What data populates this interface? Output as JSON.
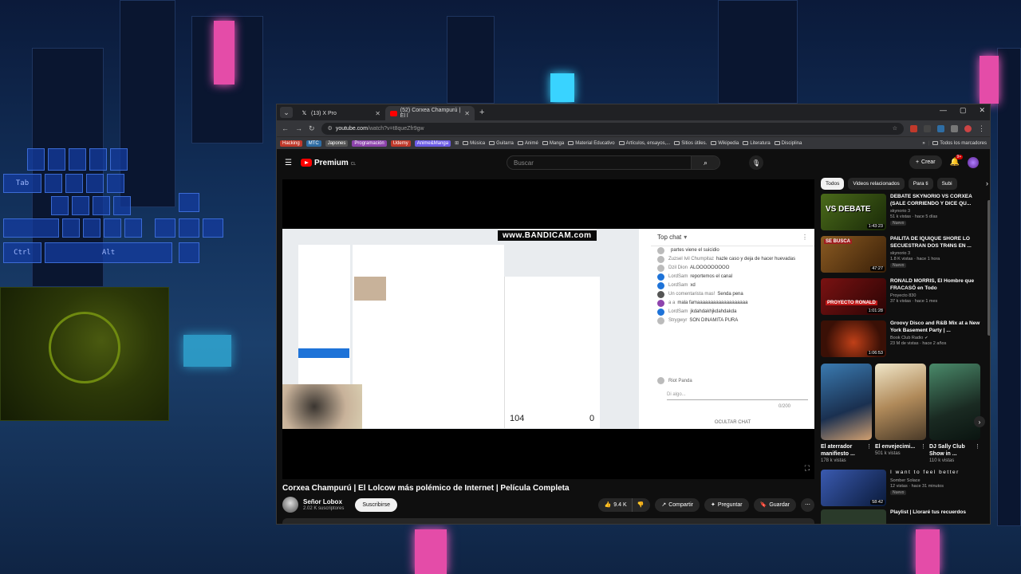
{
  "wallpaper": {
    "keyboard_keys": [
      "Tab",
      "Ctrl",
      "Alt"
    ]
  },
  "browser": {
    "tabs": [
      {
        "title": "(13) X Pro",
        "favicon": "x-logo-icon",
        "active": false
      },
      {
        "title": "(52) Corxea Champurú | El l",
        "favicon": "youtube-icon",
        "active": true
      }
    ],
    "new_tab": "+",
    "url_host": "youtube.com",
    "url_path": "/watch?v=t8queZfr9gw",
    "bookmarks": [
      {
        "label": "Hacking",
        "type": "chip",
        "color": "#c0392b"
      },
      {
        "label": "MTC",
        "type": "chip",
        "color": "#2e6da4"
      },
      {
        "label": "Japones",
        "type": "chip",
        "color": "#555555"
      },
      {
        "label": "Programación",
        "type": "chip",
        "color": "#8e44ad"
      },
      {
        "label": "Udemy",
        "type": "chip",
        "color": "#c0392b"
      },
      {
        "label": "Anime&Manga",
        "type": "chip",
        "color": "#6c5ce7"
      }
    ],
    "bookmark_folders": [
      "Música",
      "Guitarra",
      "Animé",
      "Manga",
      "Material Educativo",
      "Artículos, ensayos,...",
      "Sitios útiles.",
      "Wikipedia",
      "Literatura",
      "Disciplina"
    ],
    "bookmarks_overflow": "»",
    "all_bookmarks": "Todos los marcadores"
  },
  "youtube": {
    "logo_text": "Premium",
    "country": "CL",
    "search_placeholder": "Buscar",
    "create_label": "Crear",
    "notifications": "9+",
    "video": {
      "watermark": "www.BANDICAM.com",
      "top_chat": "Top chat",
      "chat_messages": [
        {
          "name": "",
          "text": "partes viene el suicidio"
        },
        {
          "name": "Zuzsel Ivil Chumpitaz",
          "text": "hazle caso y deja de hacer huevadas"
        },
        {
          "name": "Dzil Dion",
          "text": "ALOOOOOOOOO"
        },
        {
          "name": "LordSam",
          "text": "reportemos el canal"
        },
        {
          "name": "LordSam",
          "text": "xd"
        },
        {
          "name": "Un comentarista mas!",
          "text": "Senda pena"
        },
        {
          "name": "a a",
          "text": "mala famaaaaaaaaaaaaaaaaaaa"
        },
        {
          "name": "LordSam",
          "text": "jkdahdakhjkdahdakda"
        },
        {
          "name": "Strygwyr",
          "text": "SON DINAMITA PURA"
        }
      ],
      "chat_author": "Riot Panda",
      "chat_placeholder": "Di algo...",
      "chat_counter": "0/200",
      "hide_chat": "OCULTAR CHAT",
      "stat_left": "104",
      "stat_right": "0"
    },
    "title": "Corxea Champurú | El Lolcow más polémico de Internet | Película Completa",
    "channel_name": "Señor Lobox",
    "channel_subs": "2.02 K suscriptores",
    "subscribe": "Suscribirse",
    "likes": "9.4 K",
    "share": "Compartir",
    "ask": "Preguntar",
    "save": "Guardar",
    "chips": [
      "Todos",
      "Videos relacionados",
      "Para ti",
      "Subi"
    ],
    "recommendations": [
      {
        "title": "DEBATE SKYNORIO VS CORXEA (SALE CORRIENDO Y DICE QU...",
        "channel": "skynorio 3",
        "meta": "51 k vistas · hace 5 días",
        "duration": "1:43:23",
        "badge": "Nuevo",
        "thumb": "#4a6a1a",
        "thumb_text": "VS DEBATE",
        "verified": false
      },
      {
        "title": "PAILITA DE IQUIQUE SHORE LO SECUESTRAN DOS TR4NS EN ...",
        "channel": "skynorio 3",
        "meta": "1.8 K vistas · hace 1 hora",
        "duration": "47:27",
        "badge": "Nuevo",
        "thumb": "#6a3a12",
        "thumb_text": "SE BUSCA",
        "verified": false
      },
      {
        "title": "RONALD MORRIS, El Hombre que FRACASÓ en Todo",
        "channel": "Proyecto 830",
        "meta": "37 k vistas · hace 1 mes",
        "duration": "1:01:28",
        "badge": "",
        "thumb": "#5a0e0e",
        "thumb_text": "PROYECTO RONALD",
        "verified": false
      },
      {
        "title": "Groovy Disco and R&B Mix at a New York Basement Party | ...",
        "channel": "Book Club Radio",
        "meta": "23 M de vistas · hace 2 años",
        "duration": "1:06:53",
        "badge": "",
        "thumb": "#3a1a0a",
        "thumb_text": "",
        "verified": true
      }
    ],
    "shorts": [
      {
        "title": "El aterrador manifiesto ...",
        "views": "178 k vistas",
        "thumb": "#2a5a8a"
      },
      {
        "title": "El envejecimi...",
        "views": "501 k vistas",
        "thumb": "#b08a5a"
      },
      {
        "title": "DJ Sally Club Show in ...",
        "views": "110 k vistas",
        "thumb": "#2a4a3a"
      }
    ],
    "bottom_rec": {
      "title": "I want to feel better",
      "channel": "Somber Solace",
      "meta": "12 vistas · hace 31 minutos",
      "duration": "58:42",
      "badge": "Nuevo",
      "thumb": "#1a3a6a"
    },
    "partial_rec": "Playlist | Lloraré tus recuerdos"
  }
}
